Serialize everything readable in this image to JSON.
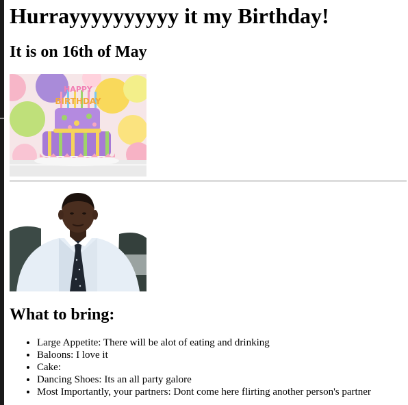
{
  "page": {
    "title": "Hurrayyyyyyyyyy it my Birthday!",
    "date_line": "It is on 16th of May",
    "images": {
      "cake": {
        "alt": "birthday cake",
        "banner_letters": [
          "HAPPY",
          "BIRTHDAY"
        ]
      },
      "person": {
        "alt": "birthday person"
      }
    },
    "bring_heading": "What to bring:",
    "items": [
      "Large Appetite: There will be alot of eating and drinking",
      "Baloons: I love it",
      "Cake:",
      "Dancing Shoes: Its an all party galore",
      "Most Importantly, your partners: Dont come here flirting another person's partner"
    ]
  },
  "colors": {
    "text": "#000000",
    "background": "#ffffff",
    "rule": "#9a9a9a"
  }
}
